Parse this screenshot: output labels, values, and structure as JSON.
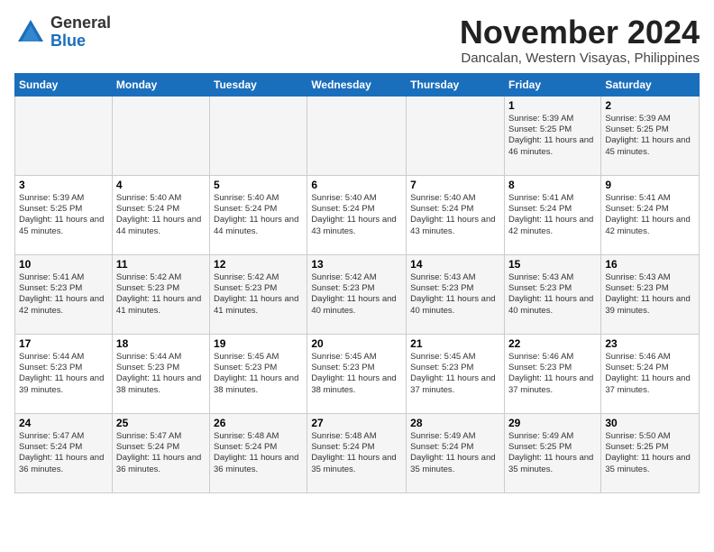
{
  "header": {
    "logo_general": "General",
    "logo_blue": "Blue",
    "month_title": "November 2024",
    "subtitle": "Dancalan, Western Visayas, Philippines"
  },
  "weekdays": [
    "Sunday",
    "Monday",
    "Tuesday",
    "Wednesday",
    "Thursday",
    "Friday",
    "Saturday"
  ],
  "weeks": [
    [
      {
        "day": "",
        "info": ""
      },
      {
        "day": "",
        "info": ""
      },
      {
        "day": "",
        "info": ""
      },
      {
        "day": "",
        "info": ""
      },
      {
        "day": "",
        "info": ""
      },
      {
        "day": "1",
        "info": "Sunrise: 5:39 AM\nSunset: 5:25 PM\nDaylight: 11 hours and 46 minutes."
      },
      {
        "day": "2",
        "info": "Sunrise: 5:39 AM\nSunset: 5:25 PM\nDaylight: 11 hours and 45 minutes."
      }
    ],
    [
      {
        "day": "3",
        "info": "Sunrise: 5:39 AM\nSunset: 5:25 PM\nDaylight: 11 hours and 45 minutes."
      },
      {
        "day": "4",
        "info": "Sunrise: 5:40 AM\nSunset: 5:24 PM\nDaylight: 11 hours and 44 minutes."
      },
      {
        "day": "5",
        "info": "Sunrise: 5:40 AM\nSunset: 5:24 PM\nDaylight: 11 hours and 44 minutes."
      },
      {
        "day": "6",
        "info": "Sunrise: 5:40 AM\nSunset: 5:24 PM\nDaylight: 11 hours and 43 minutes."
      },
      {
        "day": "7",
        "info": "Sunrise: 5:40 AM\nSunset: 5:24 PM\nDaylight: 11 hours and 43 minutes."
      },
      {
        "day": "8",
        "info": "Sunrise: 5:41 AM\nSunset: 5:24 PM\nDaylight: 11 hours and 42 minutes."
      },
      {
        "day": "9",
        "info": "Sunrise: 5:41 AM\nSunset: 5:24 PM\nDaylight: 11 hours and 42 minutes."
      }
    ],
    [
      {
        "day": "10",
        "info": "Sunrise: 5:41 AM\nSunset: 5:23 PM\nDaylight: 11 hours and 42 minutes."
      },
      {
        "day": "11",
        "info": "Sunrise: 5:42 AM\nSunset: 5:23 PM\nDaylight: 11 hours and 41 minutes."
      },
      {
        "day": "12",
        "info": "Sunrise: 5:42 AM\nSunset: 5:23 PM\nDaylight: 11 hours and 41 minutes."
      },
      {
        "day": "13",
        "info": "Sunrise: 5:42 AM\nSunset: 5:23 PM\nDaylight: 11 hours and 40 minutes."
      },
      {
        "day": "14",
        "info": "Sunrise: 5:43 AM\nSunset: 5:23 PM\nDaylight: 11 hours and 40 minutes."
      },
      {
        "day": "15",
        "info": "Sunrise: 5:43 AM\nSunset: 5:23 PM\nDaylight: 11 hours and 40 minutes."
      },
      {
        "day": "16",
        "info": "Sunrise: 5:43 AM\nSunset: 5:23 PM\nDaylight: 11 hours and 39 minutes."
      }
    ],
    [
      {
        "day": "17",
        "info": "Sunrise: 5:44 AM\nSunset: 5:23 PM\nDaylight: 11 hours and 39 minutes."
      },
      {
        "day": "18",
        "info": "Sunrise: 5:44 AM\nSunset: 5:23 PM\nDaylight: 11 hours and 38 minutes."
      },
      {
        "day": "19",
        "info": "Sunrise: 5:45 AM\nSunset: 5:23 PM\nDaylight: 11 hours and 38 minutes."
      },
      {
        "day": "20",
        "info": "Sunrise: 5:45 AM\nSunset: 5:23 PM\nDaylight: 11 hours and 38 minutes."
      },
      {
        "day": "21",
        "info": "Sunrise: 5:45 AM\nSunset: 5:23 PM\nDaylight: 11 hours and 37 minutes."
      },
      {
        "day": "22",
        "info": "Sunrise: 5:46 AM\nSunset: 5:23 PM\nDaylight: 11 hours and 37 minutes."
      },
      {
        "day": "23",
        "info": "Sunrise: 5:46 AM\nSunset: 5:24 PM\nDaylight: 11 hours and 37 minutes."
      }
    ],
    [
      {
        "day": "24",
        "info": "Sunrise: 5:47 AM\nSunset: 5:24 PM\nDaylight: 11 hours and 36 minutes."
      },
      {
        "day": "25",
        "info": "Sunrise: 5:47 AM\nSunset: 5:24 PM\nDaylight: 11 hours and 36 minutes."
      },
      {
        "day": "26",
        "info": "Sunrise: 5:48 AM\nSunset: 5:24 PM\nDaylight: 11 hours and 36 minutes."
      },
      {
        "day": "27",
        "info": "Sunrise: 5:48 AM\nSunset: 5:24 PM\nDaylight: 11 hours and 35 minutes."
      },
      {
        "day": "28",
        "info": "Sunrise: 5:49 AM\nSunset: 5:24 PM\nDaylight: 11 hours and 35 minutes."
      },
      {
        "day": "29",
        "info": "Sunrise: 5:49 AM\nSunset: 5:25 PM\nDaylight: 11 hours and 35 minutes."
      },
      {
        "day": "30",
        "info": "Sunrise: 5:50 AM\nSunset: 5:25 PM\nDaylight: 11 hours and 35 minutes."
      }
    ]
  ]
}
